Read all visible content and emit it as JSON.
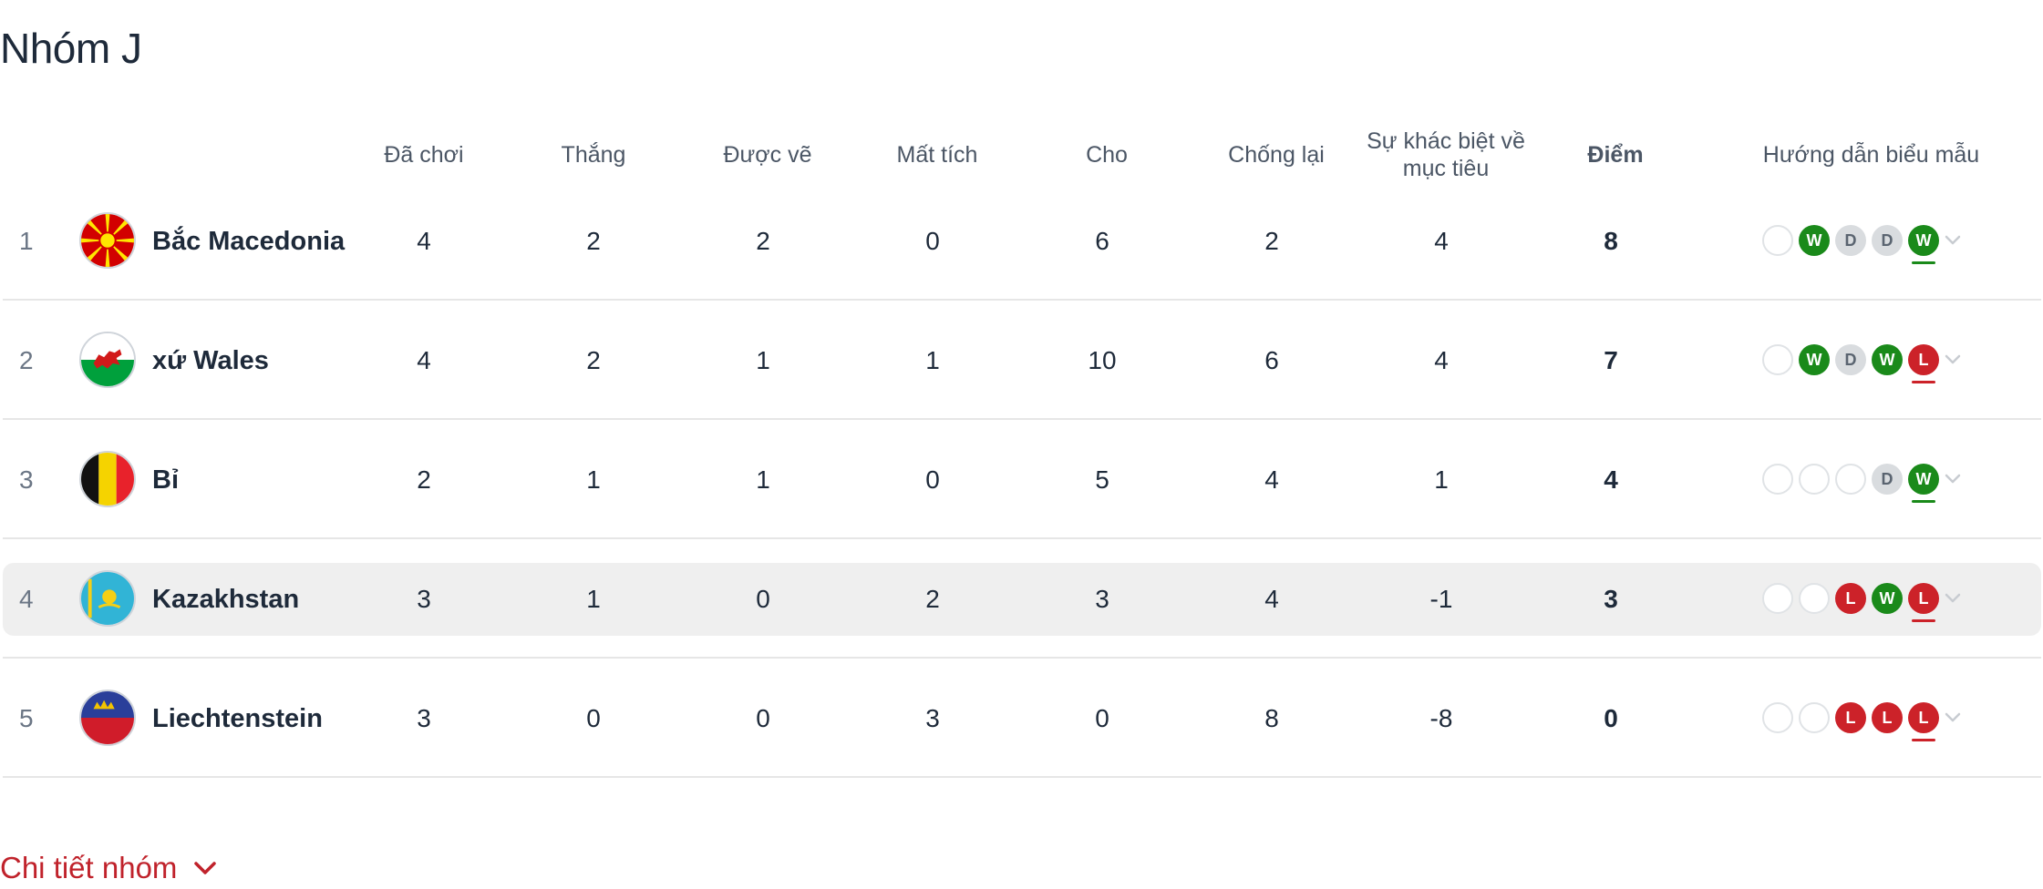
{
  "group_title": "Nhóm J",
  "headers": {
    "played": "Đã chơi",
    "won": "Thắng",
    "drawn": "Được vẽ",
    "lost": "Mất tích",
    "for": "Cho",
    "against": "Chống lại",
    "goal_diff": "Sự khác biệt về mục tiêu",
    "points": "Điểm",
    "form": "Hướng dẫn biểu mẫu"
  },
  "rows": [
    {
      "pos": "1",
      "team": "Bắc Macedonia",
      "flag": "north-macedonia-flag",
      "played": "4",
      "won": "2",
      "drawn": "2",
      "lost": "0",
      "for": "6",
      "against": "2",
      "gd": "4",
      "pts": "8",
      "form": [
        "",
        "W",
        "D",
        "D",
        "W"
      ]
    },
    {
      "pos": "2",
      "team": "xứ Wales",
      "flag": "wales-flag",
      "played": "4",
      "won": "2",
      "drawn": "1",
      "lost": "1",
      "for": "10",
      "against": "6",
      "gd": "4",
      "pts": "7",
      "form": [
        "",
        "W",
        "D",
        "W",
        "L"
      ]
    },
    {
      "pos": "3",
      "team": "Bỉ",
      "flag": "belgium-flag",
      "played": "2",
      "won": "1",
      "drawn": "1",
      "lost": "0",
      "for": "5",
      "against": "4",
      "gd": "1",
      "pts": "4",
      "form": [
        "",
        "",
        "",
        "D",
        "W"
      ]
    },
    {
      "pos": "4",
      "team": "Kazakhstan",
      "flag": "kazakhstan-flag",
      "played": "3",
      "won": "1",
      "drawn": "0",
      "lost": "2",
      "for": "3",
      "against": "4",
      "gd": "-1",
      "pts": "3",
      "form": [
        "",
        "",
        "L",
        "W",
        "L"
      ]
    },
    {
      "pos": "5",
      "team": "Liechtenstein",
      "flag": "liechtenstein-flag",
      "played": "3",
      "won": "0",
      "drawn": "0",
      "lost": "3",
      "for": "0",
      "against": "8",
      "gd": "-8",
      "pts": "0",
      "form": [
        "",
        "",
        "L",
        "L",
        "L"
      ]
    }
  ],
  "details_link": "Chi tiết nhóm",
  "colors": {
    "win": "#1a8a1a",
    "draw": "#d9dcdf",
    "loss": "#cc2229",
    "link": "#c0222b"
  }
}
